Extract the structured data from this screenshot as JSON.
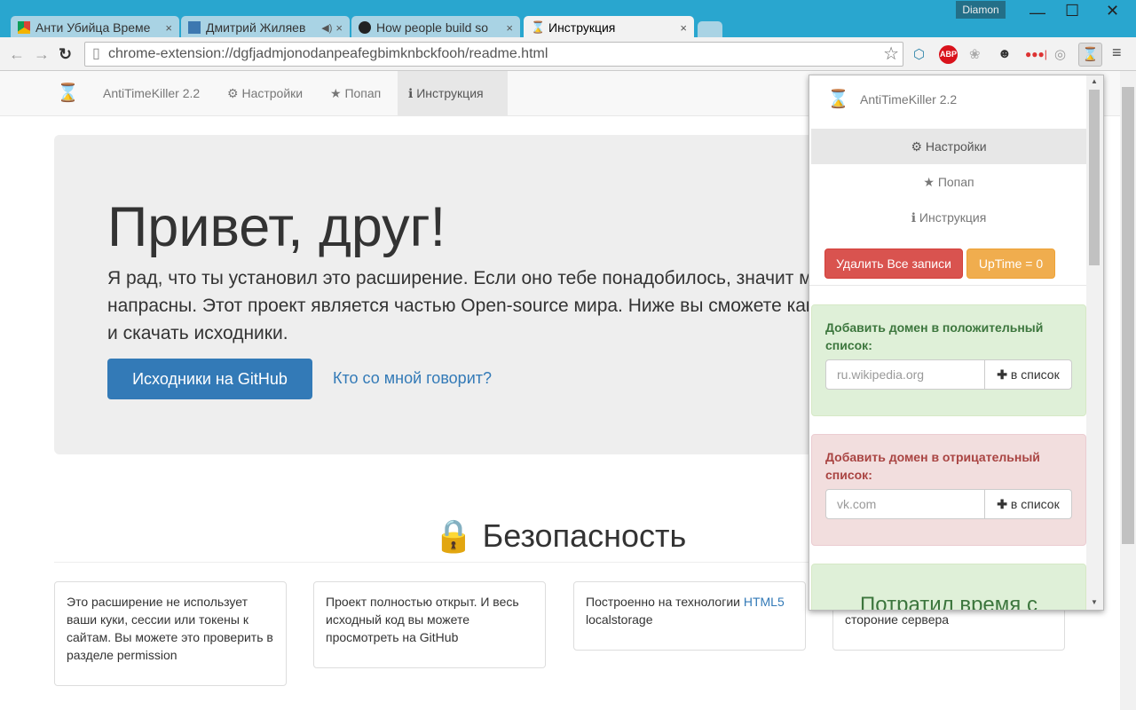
{
  "browser": {
    "tabs": [
      {
        "title": "Анти Убийца Време",
        "close": "×"
      },
      {
        "title": "Дмитрий Жиляев",
        "close": "×"
      },
      {
        "title": "How people build so",
        "close": "×"
      },
      {
        "title": "Инструкция",
        "close": "×"
      }
    ],
    "user": "Diamon",
    "url": "chrome-extension://dgfjadmjonodanpeafegbimknbckfooh/readme.html",
    "extensions": [
      "extension-icon",
      "abp-icon",
      "paw-icon",
      "panda-icon",
      "dots-icon",
      "leaf-icon",
      "hourglass-icon"
    ],
    "abp_label": "ABP"
  },
  "navbar": {
    "brand": "AntiTimeKiller 2.2",
    "items": [
      {
        "label": "Настройки",
        "icon": "gear-icon"
      },
      {
        "label": "Попап",
        "icon": "star-icon"
      },
      {
        "label": "Инструкция",
        "icon": "info-icon",
        "active": true
      }
    ]
  },
  "jumbotron": {
    "title": "Привет, друг!",
    "text": "Я рад, что ты установил это расширение. Если оно тебе понадобилось, значит мои старания были не напрасны. Этот проект является частью Open-source мира. Ниже вы сможете как пожаловаться на баги так и скачать исходники.",
    "github_button": "Исходники на  GitHub",
    "link": "Кто со мной говорит?"
  },
  "security": {
    "title": "Безопасность",
    "cards": [
      {
        "text": "Это расширение не использует ваши куки, сессии или токены к сайтам. Вы можете это проверить в разделе permission"
      },
      {
        "text": "Проект полностью открыт. И весь исходный код вы можете просмотреть на GitHub"
      },
      {
        "text": "Построенно на технологии ",
        "link": "HTML5",
        "text2": " localstorage"
      },
      {
        "text": "стороние сервера"
      }
    ]
  },
  "popup": {
    "brand": "AntiTimeKiller 2.2",
    "items": [
      {
        "label": "Настройки",
        "active": true
      },
      {
        "label": "Попап"
      },
      {
        "label": "Инструкция"
      }
    ],
    "delete_button": "Удалить Все записи",
    "uptime_button": "UpTime = 0",
    "positive": {
      "label": "Добавить домен в положительный список:",
      "placeholder": "ru.wikipedia.org",
      "add": "в список"
    },
    "negative": {
      "label": "Добавить домен в отрицательный список:",
      "placeholder": "vk.com",
      "add": "в список"
    },
    "spent": "Потратил время с"
  },
  "colors": {
    "titlebar": "#29a6cf",
    "primary": "#337ab7",
    "danger": "#d9534f",
    "warning": "#f0ad4e",
    "success_bg": "#dff0d8",
    "danger_bg": "#f2dede"
  }
}
